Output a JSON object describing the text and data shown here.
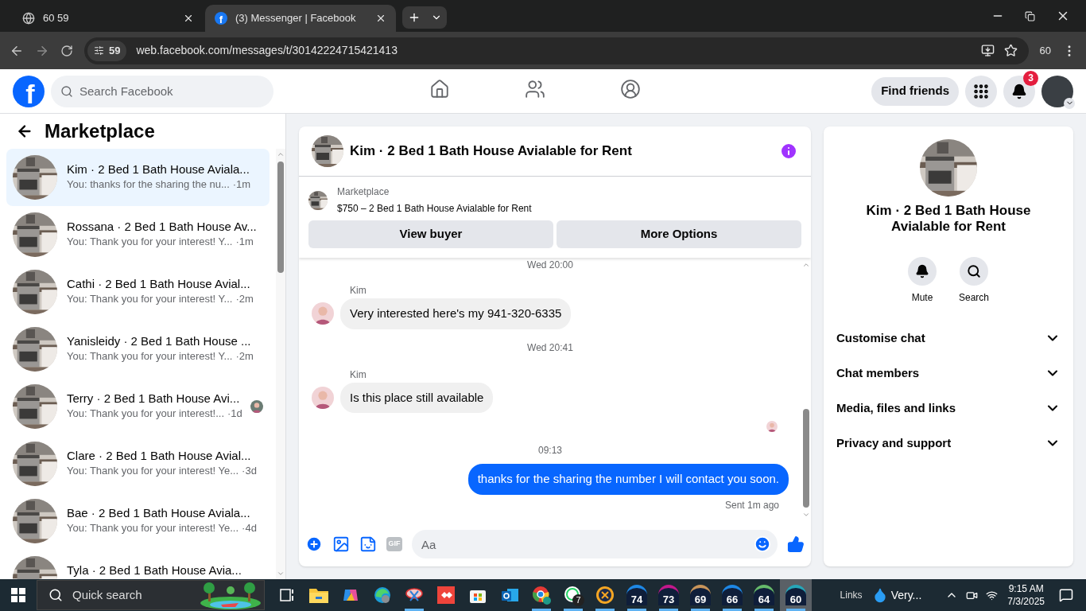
{
  "browser": {
    "tabs": [
      {
        "title": "60 59",
        "selected": false,
        "kind": "globe"
      },
      {
        "title": "(3) Messenger | Facebook",
        "selected": true,
        "kind": "facebook",
        "icon_text": "f"
      }
    ],
    "site_badge": "59",
    "url": "web.facebook.com/messages/t/30142224715421413",
    "profile_label": "60"
  },
  "header": {
    "logo": "f",
    "search": {
      "placeholder": "Search Facebook"
    },
    "find_friends": "Find friends",
    "notification_count": "3"
  },
  "sidebar": {
    "title": "Marketplace",
    "conversations": [
      {
        "name": "Kim · 2 Bed 1 Bath House Aviala...",
        "preview": "You: thanks for the sharing the nu...",
        "time": "·1m",
        "selected": true,
        "seen": false
      },
      {
        "name": "Rossana · 2 Bed 1 Bath House Av...",
        "preview": "You: Thank you for your interest! Y...",
        "time": "·1m",
        "selected": false,
        "seen": false
      },
      {
        "name": "Cathi · 2 Bed 1 Bath House Avial...",
        "preview": "You: Thank you for your interest! Y...",
        "time": "·2m",
        "selected": false,
        "seen": false
      },
      {
        "name": "Yanisleidy · 2 Bed 1 Bath House ...",
        "preview": "You: Thank you for your interest! Y...",
        "time": "·2m",
        "selected": false,
        "seen": false
      },
      {
        "name": "Terry · 2 Bed 1 Bath House Avi...",
        "preview": "You: Thank you for your interest!...",
        "time": "·1d",
        "selected": false,
        "seen": true
      },
      {
        "name": "Clare · 2 Bed 1 Bath House Avial...",
        "preview": "You: Thank you for your interest! Ye...",
        "time": "·3d",
        "selected": false,
        "seen": false
      },
      {
        "name": "Bae · 2 Bed 1 Bath House Aviala...",
        "preview": "You: Thank you for your interest! Ye...",
        "time": "·4d",
        "selected": false,
        "seen": false
      },
      {
        "name": "Tyla · 2 Bed 1 Bath House Avia...",
        "selected": false,
        "seen": false
      }
    ]
  },
  "chat": {
    "title": "Kim · 2 Bed 1 Bath House Avialable for Rent",
    "listing": {
      "label": "Marketplace",
      "text": "$750 – 2 Bed 1 Bath House Avialable for Rent"
    },
    "buttons": [
      "View buyer",
      "More Options"
    ],
    "messages": [
      {
        "kind": "time",
        "text": "Wed 20:00"
      },
      {
        "kind": "incoming",
        "sender": "Kim",
        "text": "Very interested here's my 941-320-6335"
      },
      {
        "kind": "time",
        "text": "Wed 20:41"
      },
      {
        "kind": "incoming",
        "sender": "Kim",
        "text": "Is this place still available"
      },
      {
        "kind": "seen"
      },
      {
        "kind": "time",
        "text": "09:13"
      },
      {
        "kind": "outgoing",
        "text": "thanks for the sharing the number I will contact you soon."
      },
      {
        "kind": "status",
        "text": "Sent 1m ago"
      }
    ],
    "composer": {
      "placeholder": "Aa",
      "gif_label": "GIF"
    }
  },
  "info_panel": {
    "title": "Kim · 2 Bed 1 Bath House Avialable for Rent",
    "actions": [
      {
        "label": "Mute",
        "kind": "bell"
      },
      {
        "label": "Search",
        "kind": "search"
      }
    ],
    "sections": [
      {
        "label": "Customise chat",
        "expanded": false
      },
      {
        "label": "Chat members",
        "expanded": false
      },
      {
        "label": "Media, files and links",
        "expanded": false
      },
      {
        "label": "Privacy and support",
        "expanded": false
      }
    ]
  },
  "taskbar": {
    "search": {
      "placeholder": "Quick search"
    },
    "apps": [
      {
        "kind": "taskview",
        "running": false,
        "selected": false
      },
      {
        "kind": "folder",
        "running": false,
        "selected": false
      },
      {
        "kind": "copilot",
        "running": false,
        "selected": false
      },
      {
        "kind": "edge",
        "running": false,
        "selected": false
      },
      {
        "kind": "snip",
        "running": true,
        "selected": false
      },
      {
        "kind": "anydesk",
        "running": false,
        "selected": false
      },
      {
        "kind": "store",
        "running": false,
        "selected": false
      },
      {
        "kind": "outlook",
        "running": false,
        "selected": false
      },
      {
        "kind": "chrome",
        "running": true,
        "selected": false
      },
      {
        "kind": "whatsapp",
        "badge": "7",
        "running": true,
        "selected": false
      },
      {
        "kind": "ix",
        "running": true,
        "selected": false
      },
      {
        "kind": "gauge",
        "label": "74",
        "color": "#1e88e5",
        "running": true,
        "selected": false
      },
      {
        "kind": "gauge",
        "label": "73",
        "color": "#c2188b",
        "running": true,
        "selected": false
      },
      {
        "kind": "gauge",
        "label": "69",
        "color": "#c8955a",
        "running": true,
        "selected": false
      },
      {
        "kind": "gauge",
        "label": "66",
        "color": "#1e88e5",
        "running": true,
        "selected": false
      },
      {
        "kind": "gauge",
        "label": "64",
        "color": "#66bb6a",
        "running": true,
        "selected": false
      },
      {
        "kind": "gauge",
        "label": "60",
        "color": "#26a6b8",
        "running": true,
        "selected": true
      }
    ],
    "links": "Links",
    "weather": "Very...",
    "time": "9:15 AM",
    "date": "7/3/2025"
  }
}
